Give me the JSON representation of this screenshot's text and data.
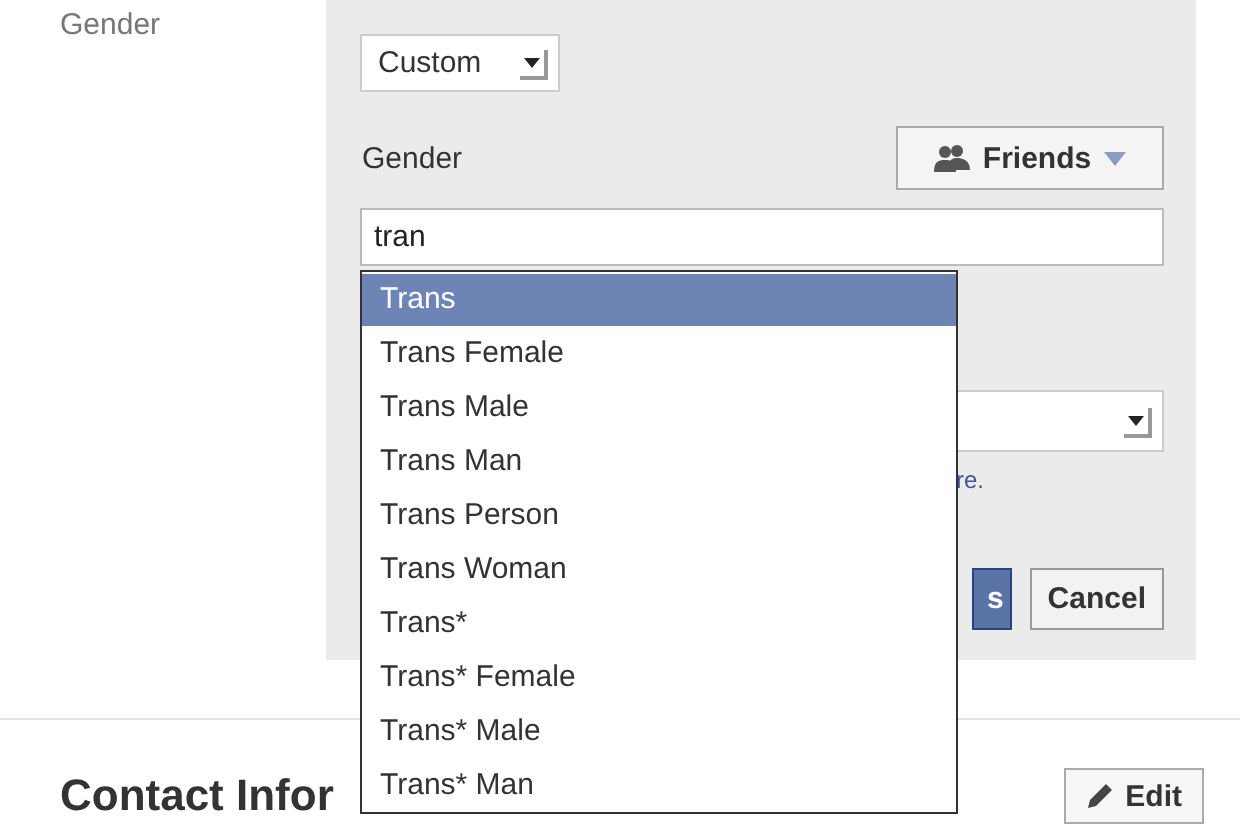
{
  "field_label": "Gender",
  "editor": {
    "type_select": {
      "value": "Custom"
    },
    "gender_label": "Gender",
    "audience_button": {
      "label": "Friends"
    },
    "gender_input": {
      "value": "tran"
    },
    "hint_fragment": "re.",
    "buttons": [
      {
        "label": "s",
        "kind": "primary"
      },
      {
        "label": "Cancel",
        "kind": "secondary"
      }
    ]
  },
  "suggestions": [
    {
      "label": "Trans",
      "selected": true
    },
    {
      "label": "Trans Female",
      "selected": false
    },
    {
      "label": "Trans Male",
      "selected": false
    },
    {
      "label": "Trans Man",
      "selected": false
    },
    {
      "label": "Trans Person",
      "selected": false
    },
    {
      "label": "Trans Woman",
      "selected": false
    },
    {
      "label": "Trans*",
      "selected": false
    },
    {
      "label": "Trans* Female",
      "selected": false
    },
    {
      "label": "Trans* Male",
      "selected": false
    },
    {
      "label": "Trans* Man",
      "selected": false
    }
  ],
  "section": {
    "title": "Contact Infor",
    "edit_button": "Edit"
  }
}
